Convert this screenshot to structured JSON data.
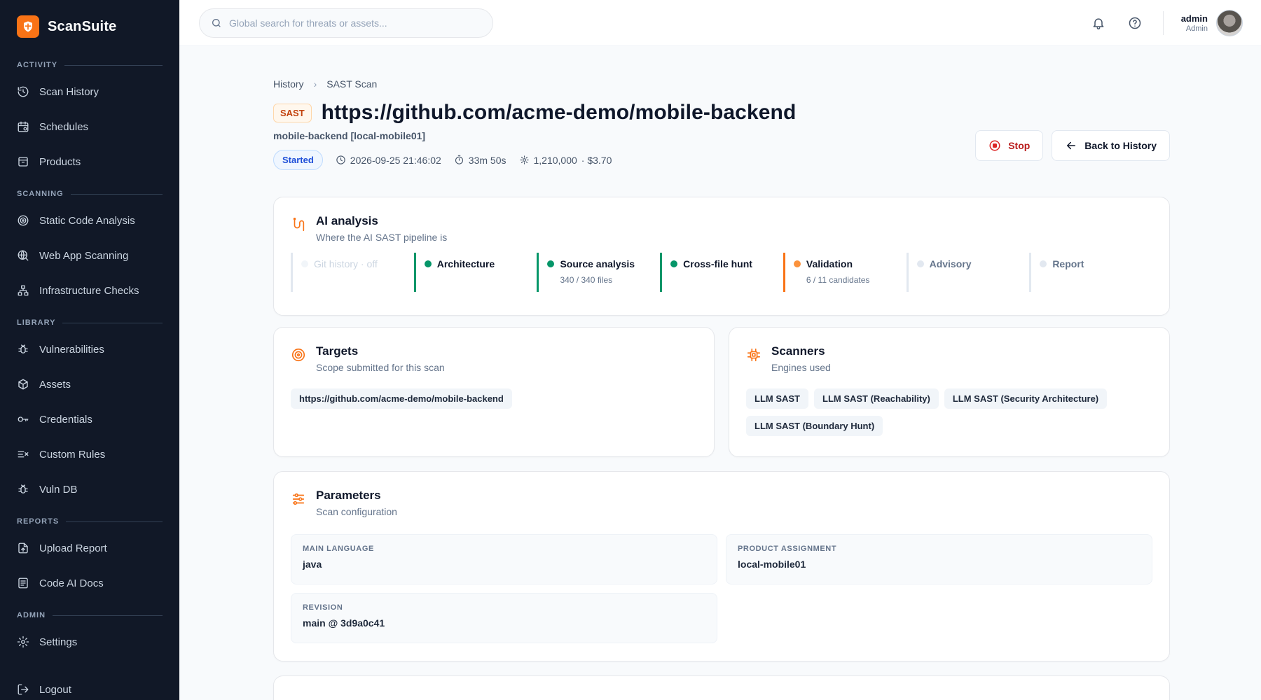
{
  "brand": {
    "name": "ScanSuite"
  },
  "sidebar": {
    "sections": [
      {
        "title": "ACTIVITY",
        "items": [
          {
            "label": "Scan History",
            "icon": "history-icon"
          },
          {
            "label": "Schedules",
            "icon": "calendar-icon"
          },
          {
            "label": "Products",
            "icon": "archive-icon"
          }
        ]
      },
      {
        "title": "SCANNING",
        "items": [
          {
            "label": "Static Code Analysis",
            "icon": "target-icon"
          },
          {
            "label": "Web App Scanning",
            "icon": "globe-search-icon"
          },
          {
            "label": "Infrastructure Checks",
            "icon": "network-icon"
          }
        ]
      },
      {
        "title": "LIBRARY",
        "items": [
          {
            "label": "Vulnerabilities",
            "icon": "bug-icon"
          },
          {
            "label": "Assets",
            "icon": "box-icon"
          },
          {
            "label": "Credentials",
            "icon": "key-icon"
          },
          {
            "label": "Custom Rules",
            "icon": "rules-icon"
          },
          {
            "label": "Vuln DB",
            "icon": "bug-icon"
          }
        ]
      },
      {
        "title": "REPORTS",
        "items": [
          {
            "label": "Upload Report",
            "icon": "file-upload-icon"
          },
          {
            "label": "Code AI Docs",
            "icon": "document-icon"
          }
        ]
      },
      {
        "title": "ADMIN",
        "items": [
          {
            "label": "Settings",
            "icon": "gear-icon"
          }
        ]
      }
    ],
    "logout": "Logout"
  },
  "topbar": {
    "search_placeholder": "Global search for threats or assets...",
    "user_name": "admin",
    "user_role": "Admin"
  },
  "breadcrumb": {
    "parent": "History",
    "current": "SAST Scan"
  },
  "scan": {
    "type_badge": "SAST",
    "title": "https://github.com/acme-demo/mobile-backend",
    "subtitle": "mobile-backend [local-mobile01]",
    "status": "Started",
    "started_at": "2026-09-25 21:46:02",
    "duration": "33m 50s",
    "tokens": "1,210,000",
    "cost": "· $3.70"
  },
  "actions": {
    "stop": "Stop",
    "back": "Back to History"
  },
  "ai_analysis": {
    "title": "AI analysis",
    "desc": "Where the AI SAST pipeline is",
    "stages": [
      {
        "name": "Git history · off",
        "detail": "",
        "state": "off"
      },
      {
        "name": "Architecture",
        "detail": "",
        "state": "done"
      },
      {
        "name": "Source analysis",
        "detail": "340 / 340 files",
        "state": "done"
      },
      {
        "name": "Cross-file hunt",
        "detail": "",
        "state": "done"
      },
      {
        "name": "Validation",
        "detail": "6 / 11 candidates",
        "state": "active"
      },
      {
        "name": "Advisory",
        "detail": "",
        "state": "pending"
      },
      {
        "name": "Report",
        "detail": "",
        "state": "pending"
      }
    ]
  },
  "targets": {
    "title": "Targets",
    "desc": "Scope submitted for this scan",
    "items": [
      "https://github.com/acme-demo/mobile-backend"
    ]
  },
  "scanners": {
    "title": "Scanners",
    "desc": "Engines used",
    "items": [
      "LLM SAST",
      "LLM SAST (Reachability)",
      "LLM SAST (Security Architecture)",
      "LLM SAST (Boundary Hunt)"
    ]
  },
  "parameters": {
    "title": "Parameters",
    "desc": "Scan configuration",
    "items": [
      {
        "label": "MAIN LANGUAGE",
        "value": "java"
      },
      {
        "label": "PRODUCT ASSIGNMENT",
        "value": "local-mobile01"
      },
      {
        "label": "REVISION",
        "value": "main @ 3d9a0c41"
      }
    ]
  },
  "colors": {
    "accent": "#f97316",
    "sidebar_bg": "#111827",
    "done": "#059669",
    "stop": "#dc2626",
    "status_blue": "#1d4ed8"
  }
}
